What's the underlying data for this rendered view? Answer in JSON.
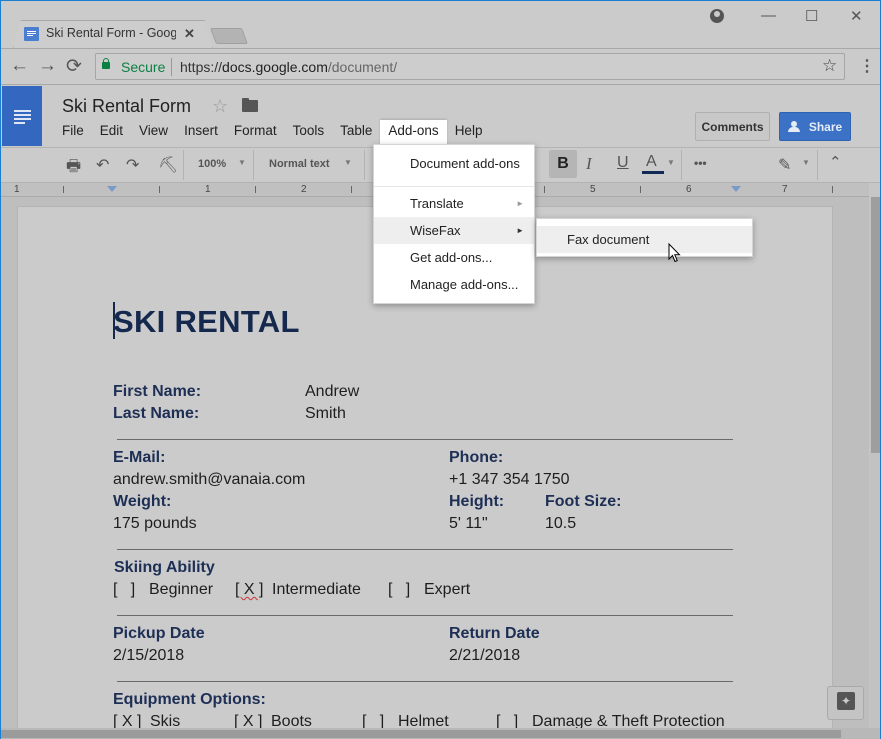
{
  "browser": {
    "tab_title": "Ski Rental Form - Google Docs",
    "tab_close_glyph": "✕",
    "secure_label": "Secure",
    "url_scheme": "https://",
    "url_host": "docs.google.com",
    "url_path": "/document/",
    "icons": {
      "back": "←",
      "forward": "→",
      "reload": "⟳",
      "bookmark": "☆",
      "menu": "⋮",
      "minimize": "—",
      "maximize": "☐",
      "close": "✕"
    }
  },
  "docs": {
    "title": "Ski Rental Form",
    "star_glyph": "☆",
    "menus": [
      "File",
      "Edit",
      "View",
      "Insert",
      "Format",
      "Tools",
      "Table",
      "Add-ons",
      "Help"
    ],
    "active_menu": "Add-ons",
    "comments_label": "Comments",
    "share_label": "Share"
  },
  "toolbar": {
    "zoom": "100%",
    "style": "Normal text",
    "bold": "B",
    "italic": "I",
    "underline": "U",
    "text_color": "A",
    "more": "•••",
    "text_color_hex": "#102a55"
  },
  "ruler": {
    "labels": [
      "1",
      "1",
      "2",
      "5",
      "6",
      "7"
    ]
  },
  "addons_menu": {
    "items": [
      {
        "label": "Document add-ons",
        "has_submenu": false
      },
      {
        "label": "Translate",
        "has_submenu": true
      },
      {
        "label": "WiseFax",
        "has_submenu": true,
        "highlighted": true
      },
      {
        "label": "Get add-ons...",
        "has_submenu": false
      },
      {
        "label": "Manage add-ons...",
        "has_submenu": false
      }
    ],
    "submenu_arrow": "►"
  },
  "wisefax_submenu": {
    "items": [
      {
        "label": "Fax document",
        "highlighted": true
      }
    ]
  },
  "document": {
    "heading": "SKI RENTAL",
    "first_name_label": "First Name:",
    "first_name": "Andrew",
    "last_name_label": "Last Name:",
    "last_name": "Smith",
    "email_label": "E-Mail:",
    "email": "andrew.smith@vanaia.com",
    "phone_label": "Phone:",
    "phone": "+1 347 354 1750",
    "weight_label": "Weight:",
    "weight": "175 pounds",
    "height_label": "Height:",
    "height": "5' 11\"",
    "foot_size_label": "Foot Size:",
    "foot_size": "10.5",
    "skiing_ability_label": "Skiing Ability",
    "skiing_ability": [
      {
        "mark": "[   ]",
        "label": "Beginner"
      },
      {
        "mark": "[ X ]",
        "label": "Intermediate"
      },
      {
        "mark": "[   ]",
        "label": "Expert"
      }
    ],
    "pickup_label": "Pickup Date",
    "pickup_date": "2/15/2018",
    "return_label": "Return Date",
    "return_date": "2/21/2018",
    "equipment_label": "Equipment Options:",
    "equipment": [
      {
        "mark": "[ X ]",
        "label": "Skis"
      },
      {
        "mark": "[ X ]",
        "label": "Boots"
      },
      {
        "mark": "[   ]",
        "label": "Helmet"
      },
      {
        "mark": "[   ]",
        "label": "Damage & Theft Protection"
      }
    ]
  }
}
